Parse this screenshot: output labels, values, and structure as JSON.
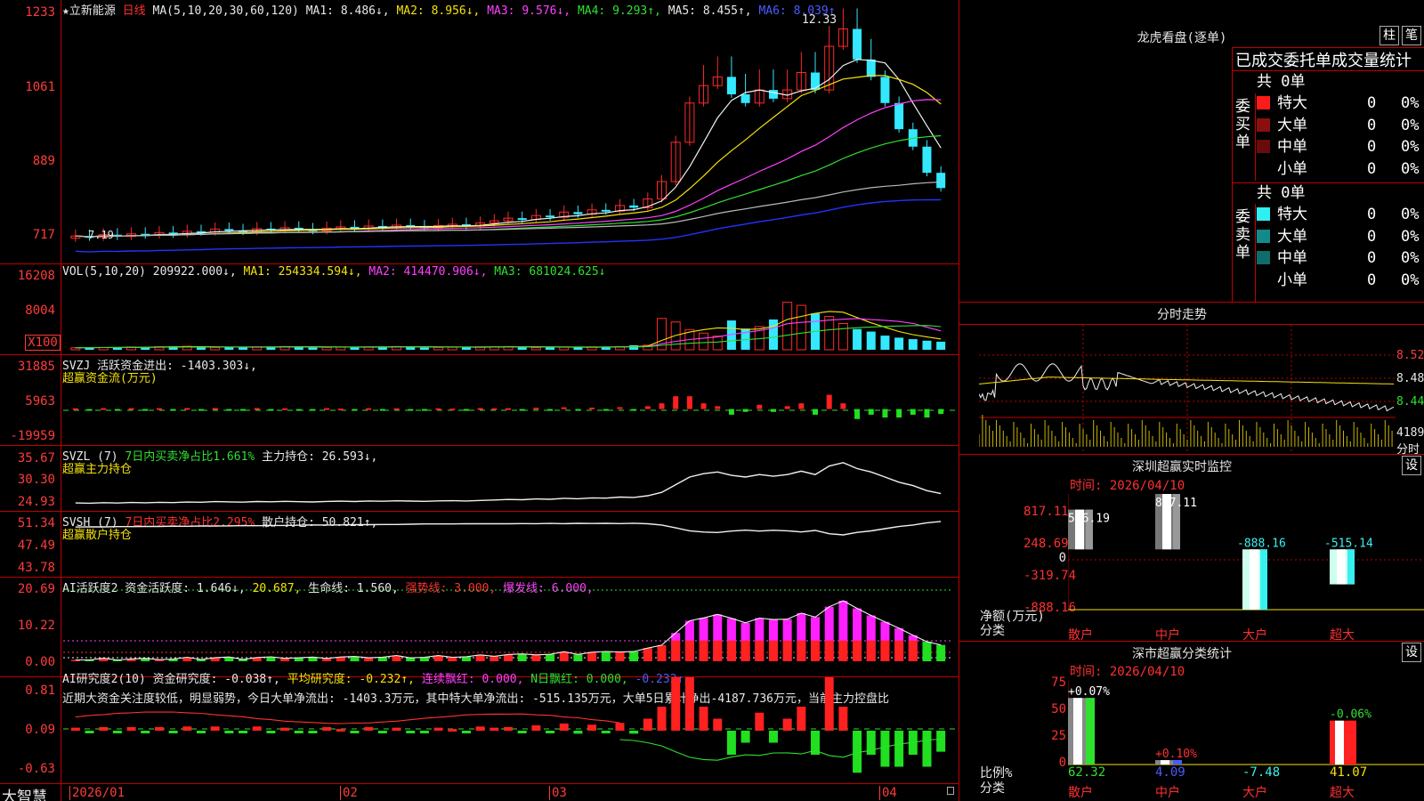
{
  "main": {
    "stock_name": "★立新能源",
    "period": "日线",
    "ma_label": "MA(5,10,20,30,60,120)",
    "ma1": "MA1: 8.486↓,",
    "ma2": "MA2: 8.956↓,",
    "ma3": "MA3: 9.576↓,",
    "ma4": "MA4: 9.293↑,",
    "ma5": "MA5: 8.455↑,",
    "ma6": "MA6: 8.039↑",
    "high_mark": "12.33",
    "low_mark": "7.19",
    "yticks": [
      "1233",
      "1061",
      "889",
      "717"
    ],
    "colors": {
      "up": "#ff2a2a",
      "down": "#33e8ff"
    }
  },
  "vol": {
    "label": "VOL(5,10,20)",
    "value": "209922.000↓,",
    "ma1": "MA1: 254334.594↓,",
    "ma2": "MA2: 414470.906↓,",
    "ma3": "MA3: 681024.625↓",
    "yticks": [
      "16208",
      "8004",
      "X100"
    ]
  },
  "svzj": {
    "label": "SVZJ  活跃资金进出: -1403.303↓,",
    "sub": "超赢资金流(万元)",
    "yticks": [
      "31885",
      "5963",
      "-19959"
    ]
  },
  "svzl": {
    "label": "SVZL  (7)",
    "pct": "7日内买卖净占比1.661%",
    "hold": "主力持仓: 26.593↓,",
    "sub": "超赢主力持仓",
    "yticks": [
      "35.67",
      "30.30",
      "24.93"
    ]
  },
  "svsh": {
    "label": "SVSH  (7)",
    "pct": "7日内买卖净占比2.295%",
    "hold": "散户持仓: 50.821↑,",
    "sub": "超赢散户持仓",
    "yticks": [
      "51.34",
      "47.49",
      "43.78"
    ]
  },
  "ai1": {
    "label": "AI活跃度2 资金活跃度: 1.646↓,",
    "v2": "20.687,",
    "life": "生命线: 1.560,",
    "strong": "强势线: 3.000,",
    "burst": "爆发线: 6.000,",
    "yticks": [
      "20.69",
      "10.22",
      "0.00"
    ]
  },
  "ai2": {
    "label": "AI研究度2(10) 资金研究度: -0.038↑,",
    "avg": "平均研究度: -0.232↑,",
    "red": "连续飘红: 0.000,",
    "nred": "N日飘红: 0.000,",
    "last": "-0.232↑",
    "comment": "近期大资金关注度较低，明显弱势，今日大单净流出: -1403.3万元，其中特大单净流出: -515.135万元，大单5日累计净出-4187.736万元，当前主力控盘比",
    "yticks": [
      "0.81",
      "0.09",
      "-0.63"
    ]
  },
  "xaxis": {
    "brand": "大智慧",
    "labels": [
      "2026/01",
      "02",
      "03",
      "04"
    ]
  },
  "lhb": {
    "title": "龙虎看盘(逐单)",
    "btn1": "柱",
    "btn2": "笔",
    "subtitle": "已成交委托单成交量统计",
    "buy_side": "委买单",
    "sell_side": "委卖单",
    "buy_total": "共 0单",
    "sell_total": "共 0单",
    "buy_rows": [
      {
        "name": "特大",
        "count": "0",
        "pct": "0%",
        "color": "#ff1a1a"
      },
      {
        "name": "大单",
        "count": "0",
        "pct": "0%",
        "color": "#8b0f0f"
      },
      {
        "name": "中单",
        "count": "0",
        "pct": "0%",
        "color": "#6b0a0a"
      },
      {
        "name": "小单",
        "count": "0",
        "pct": "0%",
        "color": ""
      }
    ],
    "sell_rows": [
      {
        "name": "特大",
        "count": "0",
        "pct": "0%",
        "color": "#2ef0f0"
      },
      {
        "name": "大单",
        "count": "0",
        "pct": "0%",
        "color": "#138a8a"
      },
      {
        "name": "中单",
        "count": "0",
        "pct": "0%",
        "color": "#106c6c"
      },
      {
        "name": "小单",
        "count": "0",
        "pct": "0%",
        "color": ""
      }
    ]
  },
  "intraday": {
    "title": "分时走势",
    "yticks": [
      "8.52",
      "8.48",
      "8.44"
    ],
    "vol_tick": "4189",
    "unit": "分时"
  },
  "monitor": {
    "title": "深圳超赢实时监控",
    "btn": "设",
    "time": "时间: 2026/04/10",
    "yticks": [
      "817.11",
      "248.69",
      "0",
      "-319.74",
      "-888.16"
    ],
    "ylabel": "净额(万元)",
    "xlabel": "分类",
    "cats": [
      "散户",
      "中户",
      "大户",
      "超大"
    ],
    "values": [
      586.19,
      817.11,
      -888.16,
      -515.14
    ],
    "value_labels": [
      "586.19",
      "817.11",
      "-888.16",
      "-515.14"
    ]
  },
  "classify": {
    "title": "深市超赢分类统计",
    "btn": "设",
    "time": "时间: 2026/04/10",
    "yticks": [
      "75",
      "50",
      "25",
      "0"
    ],
    "ylabel": "比例%",
    "xlabel": "分类",
    "cats": [
      "散户",
      "中户",
      "大户",
      "超大"
    ],
    "pct_labels": [
      "+0.07%",
      "+0.10%",
      "",
      "-0.06%"
    ],
    "bottom_values": [
      "62.32",
      "4.09",
      "-7.48",
      "41.07"
    ],
    "bars": [
      62.32,
      4.09,
      0,
      41.07
    ]
  }
}
